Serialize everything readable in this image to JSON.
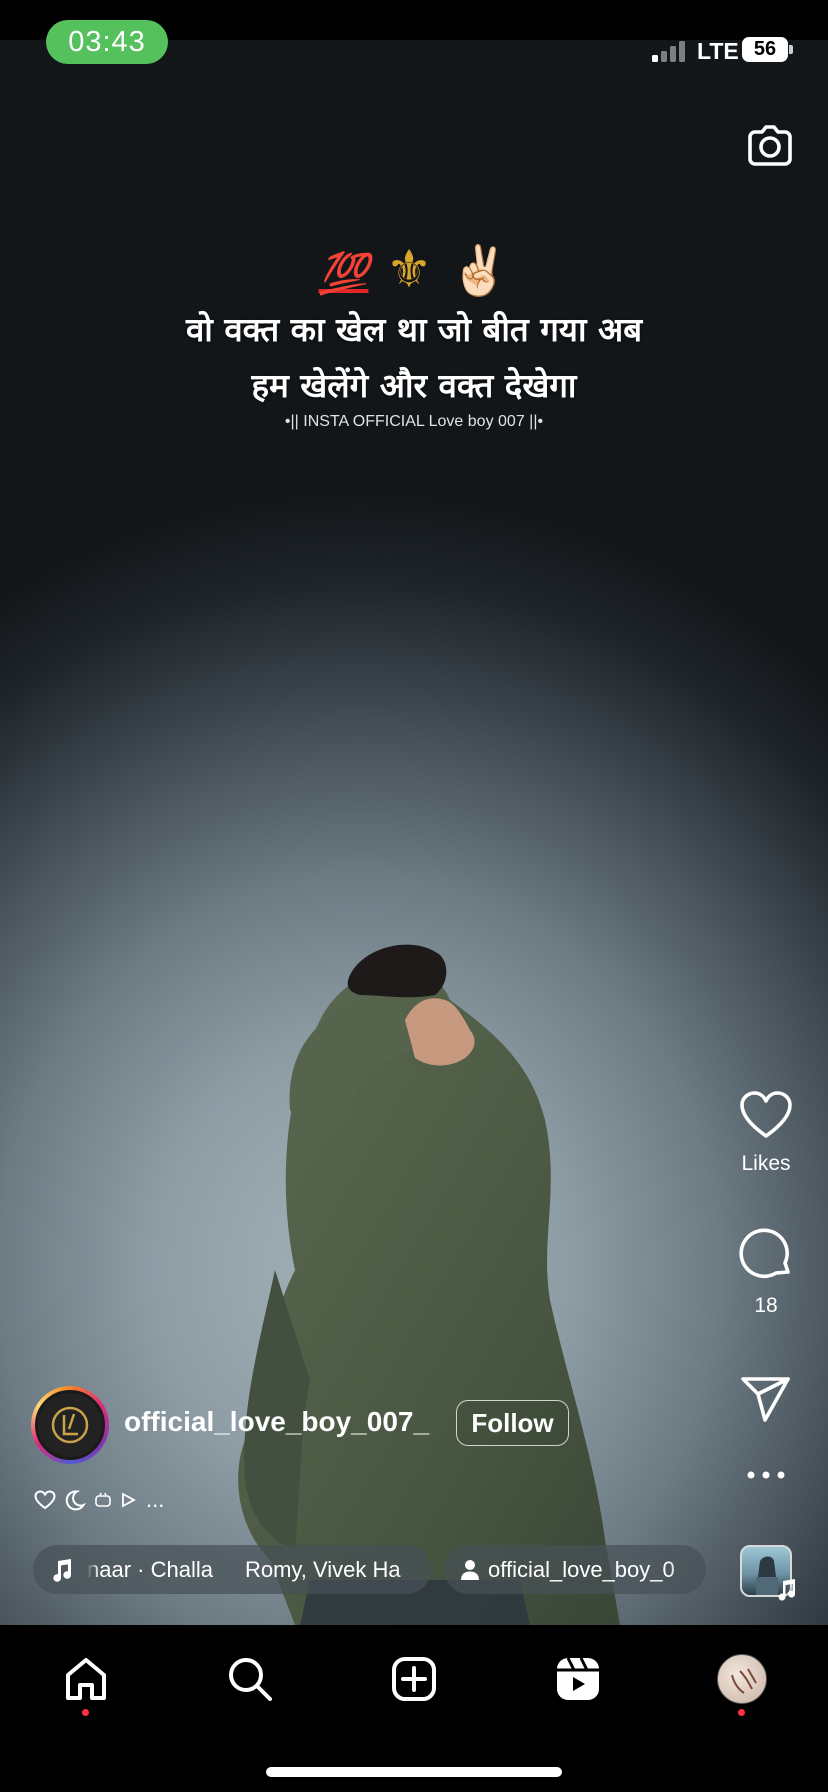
{
  "status_bar": {
    "time": "03:43",
    "network": "LTE",
    "battery": "56"
  },
  "overlay": {
    "emojis": [
      "💯",
      "⚜",
      "✌🏻"
    ],
    "line1": "वो वक्त का खेल था जो बीत गया अब",
    "line2": "हम खेलेंगे और वक्त देखेगा",
    "watermark": "•|| INSTA OFFICIAL Love boy 007 ||•"
  },
  "actions": {
    "likes_label": "Likes",
    "comments_count": "18"
  },
  "author": {
    "username": "official_love_boy_007_",
    "follow_label": "Follow"
  },
  "caption": {
    "more": "..."
  },
  "music": {
    "track_fragment": "naar · Challa",
    "artists": "Romy, Vivek Ha"
  },
  "tagged_user": {
    "name": "official_love_boy_0"
  },
  "icons": {
    "camera": "camera-icon",
    "like": "heart-icon",
    "comment": "comment-icon",
    "share": "send-icon",
    "more": "more-icon",
    "home": "home-icon",
    "search": "search-icon",
    "create": "plus-square-icon",
    "reels": "reels-icon"
  },
  "colors": {
    "time_pill": "#54c15d",
    "notification_dot": "#ff3040"
  }
}
